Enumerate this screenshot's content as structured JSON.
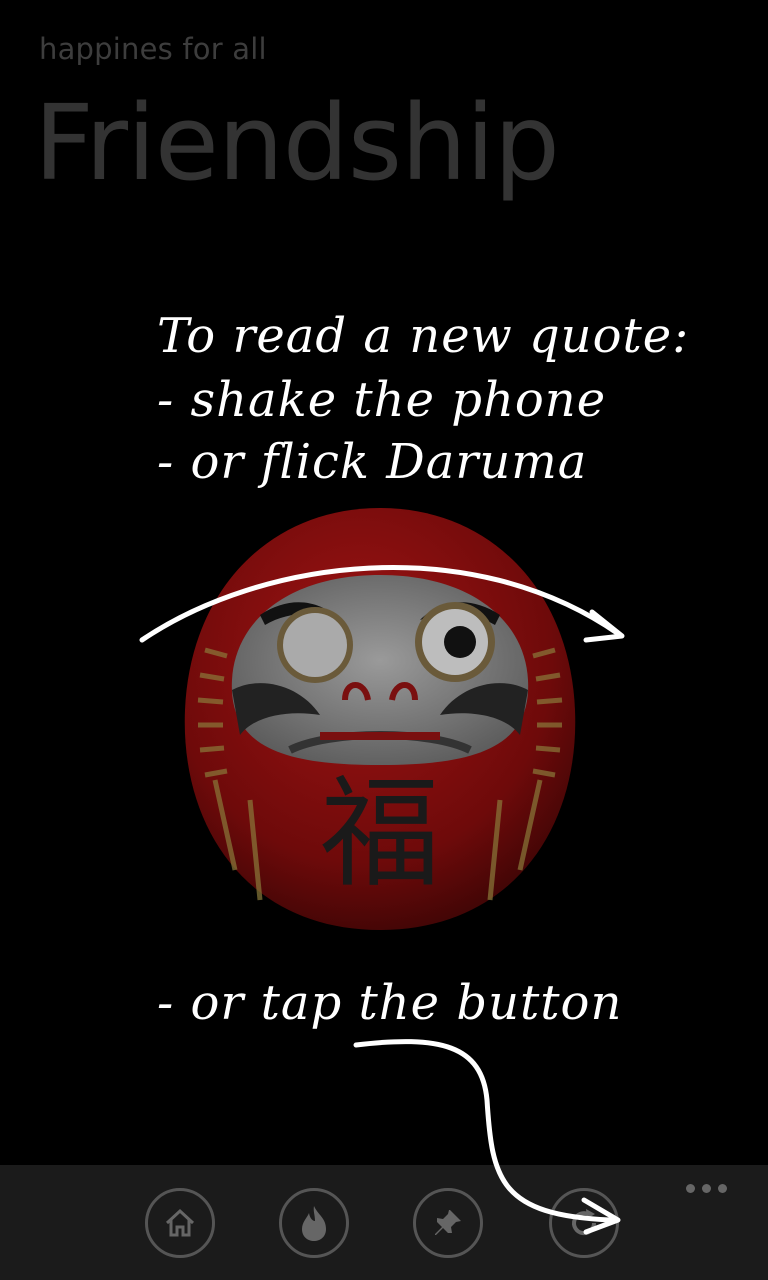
{
  "header": {
    "subtitle": "happines for all",
    "title": "Friendship"
  },
  "hints": {
    "line1": "To read a new quote:",
    "line2": "- shake the phone",
    "line3": "- or flick Daruma",
    "line4": "- or tap the button"
  },
  "daruma": {
    "character": "福",
    "icon": "daruma-doll"
  },
  "appbar": {
    "buttons": [
      {
        "icon": "home-icon"
      },
      {
        "icon": "fire-icon"
      },
      {
        "icon": "pin-icon"
      },
      {
        "icon": "refresh-icon"
      }
    ],
    "more": "more-ellipsis"
  },
  "colors": {
    "background": "#000000",
    "appbar": "#1b1b1b",
    "daruma_red": "#8b0d0d",
    "hint_text": "#ffffff"
  }
}
